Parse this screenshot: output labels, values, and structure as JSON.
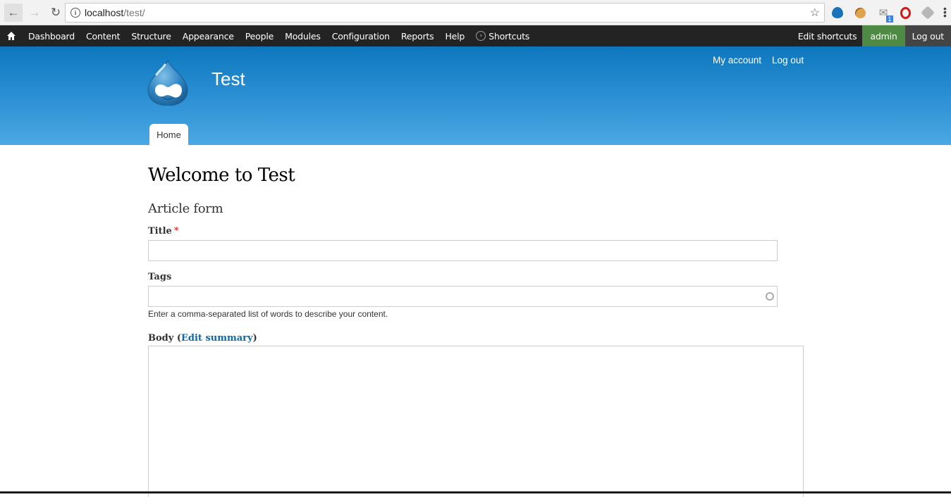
{
  "browser": {
    "url_host": "localhost",
    "url_path": "/test/",
    "extensions": [
      {
        "name": "drupal-extension"
      },
      {
        "name": "cookie-extension"
      },
      {
        "name": "mail-extension",
        "badge": "1"
      },
      {
        "name": "adblock-extension"
      },
      {
        "name": "cube-extension"
      }
    ]
  },
  "toolbar": {
    "items": [
      "Dashboard",
      "Content",
      "Structure",
      "Appearance",
      "People",
      "Modules",
      "Configuration",
      "Reports",
      "Help"
    ],
    "shortcuts_label": "Shortcuts",
    "edit_shortcuts": "Edit shortcuts",
    "user": "admin",
    "logout": "Log out",
    "colors": {
      "bar": "#232323",
      "user_bg": "#4e8a43",
      "logout_bg": "#444444"
    }
  },
  "header": {
    "site_name": "Test",
    "secondary_menu": [
      "My account",
      "Log out"
    ],
    "primary_tabs": [
      "Home"
    ],
    "gradient": [
      "#0d77bd",
      "#4aa8e4"
    ]
  },
  "content": {
    "page_title": "Welcome to Test",
    "form_title": "Article form",
    "fields": {
      "title": {
        "label": "Title",
        "required_mark": "*",
        "value": ""
      },
      "tags": {
        "label": "Tags",
        "value": "",
        "description": "Enter a comma-separated list of words to describe your content."
      },
      "body": {
        "label": "Body",
        "open_paren": "(",
        "link": "Edit summary",
        "close_paren": ")",
        "value": ""
      }
    }
  }
}
